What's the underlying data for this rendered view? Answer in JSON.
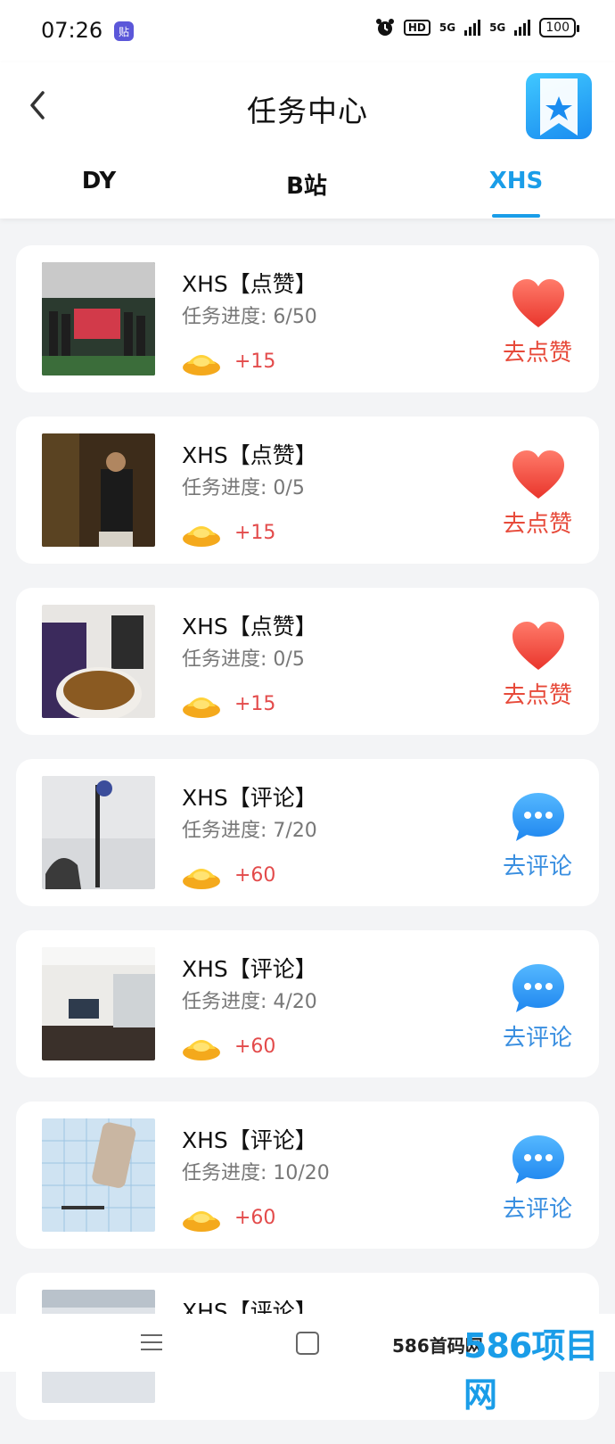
{
  "status": {
    "time": "07:26",
    "app_badge": "贴",
    "hd": "HD",
    "net1": "5G",
    "net2": "5G",
    "battery": "100"
  },
  "header": {
    "title": "任务中心"
  },
  "tabs": [
    {
      "label": "DY",
      "active": false
    },
    {
      "label": "B站",
      "active": false
    },
    {
      "label": "XHS",
      "active": true
    }
  ],
  "tasks": [
    {
      "title": "XHS【点赞】",
      "progress": "任务进度: 6/50",
      "reward": "+15",
      "action": "去点赞",
      "type": "like",
      "thumb": "group-photo"
    },
    {
      "title": "XHS【点赞】",
      "progress": "任务进度: 0/5",
      "reward": "+15",
      "action": "去点赞",
      "type": "like",
      "thumb": "person-poster"
    },
    {
      "title": "XHS【点赞】",
      "progress": "任务进度: 0/5",
      "reward": "+15",
      "action": "去点赞",
      "type": "like",
      "thumb": "tea-cup"
    },
    {
      "title": "XHS【评论】",
      "progress": "任务进度: 7/20",
      "reward": "+60",
      "action": "去评论",
      "type": "comment",
      "thumb": "vacuum-cat"
    },
    {
      "title": "XHS【评论】",
      "progress": "任务进度: 4/20",
      "reward": "+60",
      "action": "去评论",
      "type": "comment",
      "thumb": "living-room"
    },
    {
      "title": "XHS【评论】",
      "progress": "任务进度: 10/20",
      "reward": "+60",
      "action": "去评论",
      "type": "comment",
      "thumb": "appliance-tiles"
    },
    {
      "title": "XHS【评论】",
      "progress": "",
      "reward": "",
      "action": "",
      "type": "comment",
      "thumb": "partial"
    }
  ],
  "watermark": {
    "text": "586首码网",
    "logo": "586项目网"
  },
  "colors": {
    "accent": "#1a9de8",
    "like": "#e74a3a",
    "comment": "#3a8fe0",
    "reward": "#e34b4b"
  }
}
